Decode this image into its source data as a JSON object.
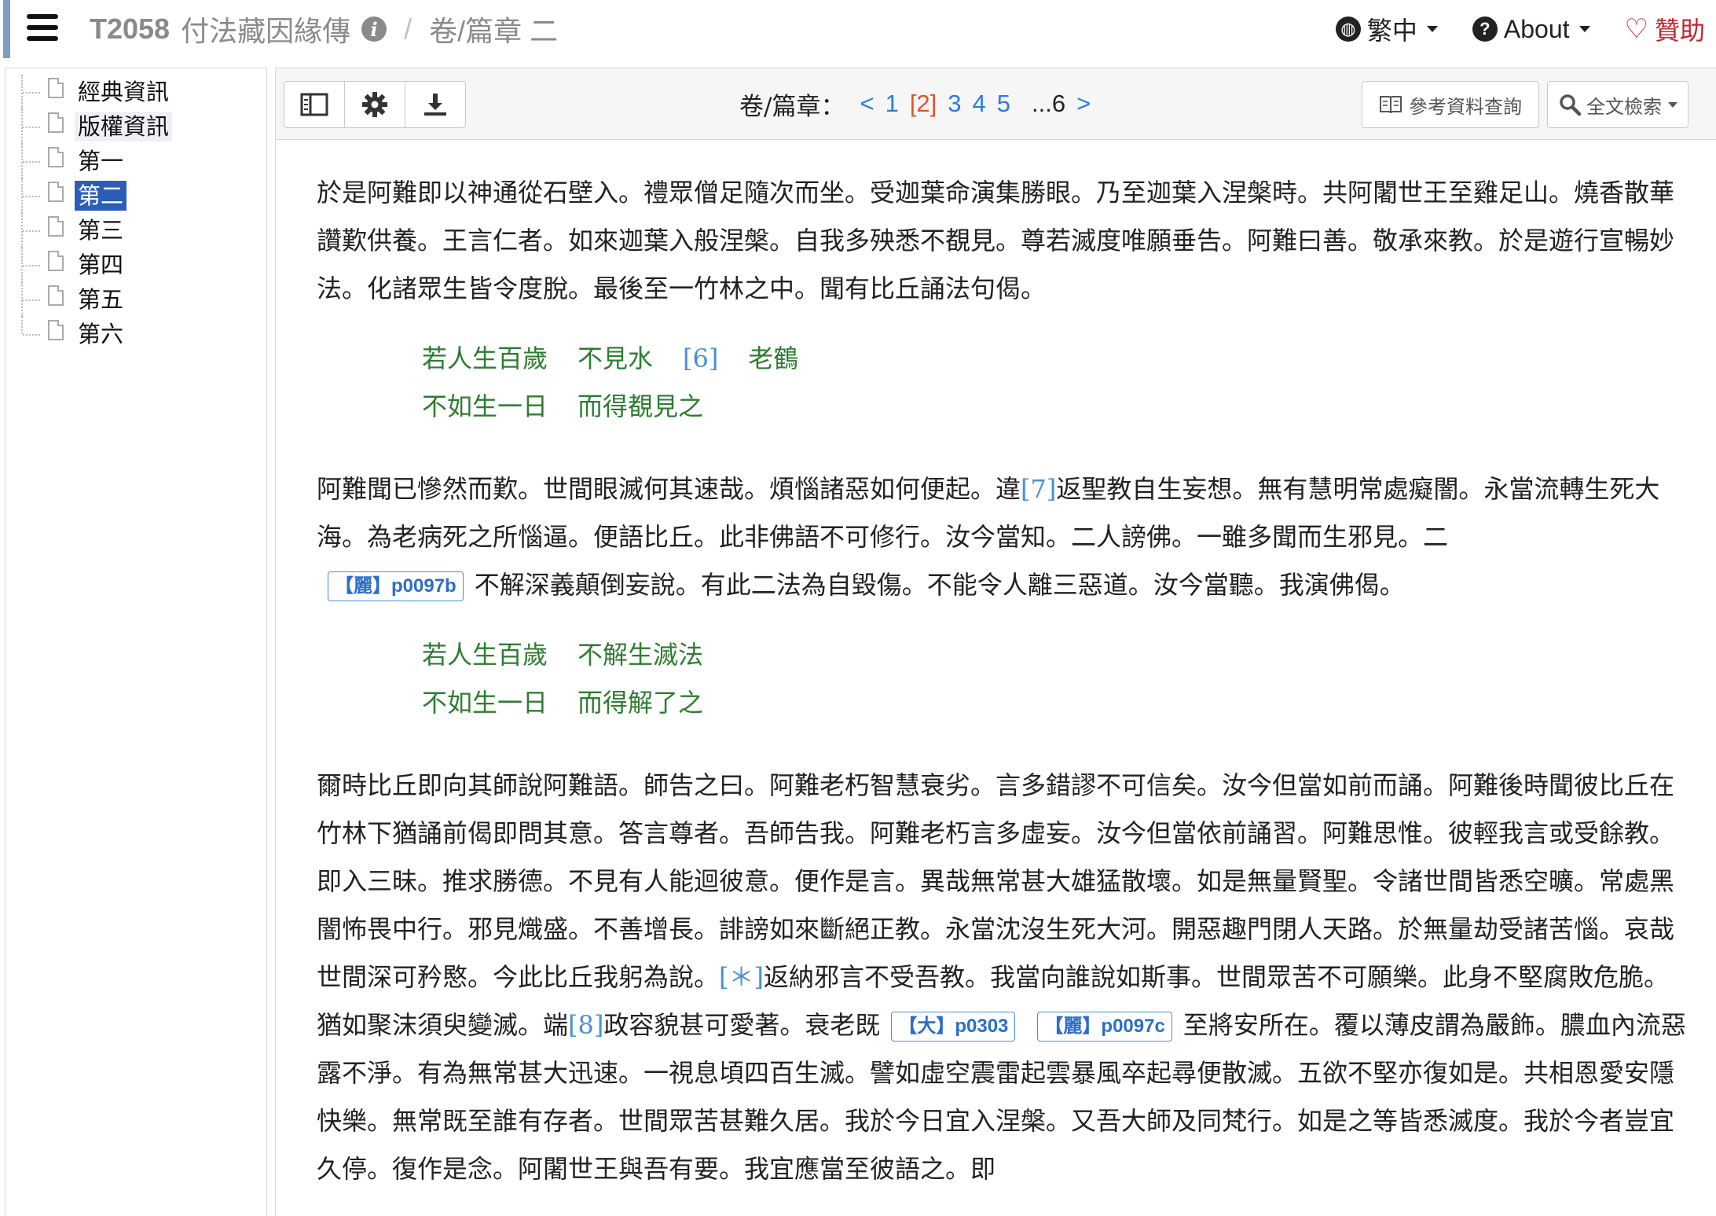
{
  "header": {
    "text_code": "T2058",
    "text_title": "付法藏因緣傳",
    "separator": "/",
    "section": "卷/篇章 二",
    "language_label": "繁中",
    "about_label": "About",
    "donate_label": "贊助",
    "icons": {
      "menu": "hamburger-icon",
      "info": "info-icon",
      "language": "globe-icon",
      "about": "question-circle-icon",
      "donate": "heart-icon"
    }
  },
  "sidebar": {
    "items": [
      {
        "label": "經典資訊"
      },
      {
        "label": "版權資訊"
      },
      {
        "label": "第一"
      },
      {
        "label": "第二"
      },
      {
        "label": "第三"
      },
      {
        "label": "第四"
      },
      {
        "label": "第五"
      },
      {
        "label": "第六"
      }
    ],
    "selected": "第二"
  },
  "toolbar": {
    "juan_label": "卷/篇章：",
    "prev": "<",
    "pages": [
      "1",
      "[2]",
      "3",
      "4",
      "5"
    ],
    "ellipsis_page": "...6",
    "next": ">",
    "current": "[2]",
    "ref_label": "參考資料查詢",
    "search_label": "全文檢索"
  },
  "content": {
    "p1": "於是阿難即以神通從石壁入。禮眾僧足隨次而坐。受迦葉命演集勝眼。乃至迦葉入涅槃時。共阿闍世王至雞足山。燒香散華讚歎供養。王言仁者。如來迦葉入般涅槃。自我多殃悉不覩見。尊若滅度唯願垂告。阿難曰善。敬承來教。於是遊行宣暢妙法。化諸眾生皆令度脫。最後至一竹林之中。聞有比丘誦法句偈。",
    "verse1": {
      "l1a": "若人生百歲",
      "l1b_pre": "不見水",
      "l1b_note": "[6]",
      "l1b_post": "老鶴",
      "l2a": "不如生一日",
      "l2b": "而得覩見之"
    },
    "p2": {
      "a": "阿難聞已慘然而歎。世間眼滅何其速哉。煩惱諸惡如何便起。違",
      "note": "[7]",
      "b": "返聖教自生妄想。無有慧明常處癡闇。永當流轉生死大海。為老病死之所惱逼。便語比丘。此非佛語不可修行。汝今當知。二人謗佛。一雖多聞而生邪見。二",
      "badge": "【麗】p0097b",
      "c": "不解深義顛倒妄說。有此二法為自毀傷。不能令人離三惡道。汝今當聽。我演佛偈。"
    },
    "verse2": {
      "l1a": "若人生百歲",
      "l1b": "不解生滅法",
      "l2a": "不如生一日",
      "l2b": "而得解了之"
    },
    "p3": {
      "a": "爾時比丘即向其師說阿難語。師告之曰。阿難老朽智慧衰劣。言多錯謬不可信矣。汝今但當如前而誦。阿難後時聞彼比丘在竹林下猶誦前偈即問其意。答言尊者。吾師告我。阿難老朽言多虛妄。汝今但當依前誦習。阿難思惟。彼輕我言或受餘教。即入三昧。推求勝德。不見有人能迴彼意。便作是言。異哉無常甚大雄猛散壞。如是無量賢聖。令諸世間皆悉空曠。常處黑闇怖畏中行。邪見熾盛。不善增長。誹謗如來斷絕正教。永當沈沒生死大河。開惡趣門閉人天路。於無量劫受諸苦惱。哀哉世間深可矜愍。今此比丘我躬為說。",
      "note1": "[＊]",
      "b": "返納邪言不受吾教。我當向誰說如斯事。世間眾苦不可願樂。此身不堅腐敗危脆。猶如聚沫須臾變滅。端",
      "note2": "[8]",
      "c": "政容貌甚可愛著。衰老既",
      "badge1": "【大】p0303",
      "badge2": "【麗】p0097c",
      "d": "至將安所在。覆以薄皮謂為嚴飾。膿血內流惡露不淨。有為無常甚大迅速。一視息頃四百生滅。譬如虛空震雷起雲暴風卒起尋便散滅。五欲不堅亦復如是。共相恩愛安隱快樂。無常既至誰有存者。世間眾苦甚難久居。我於今日宜入涅槃。又吾大師及同梵行。如是之等皆悉滅度。我於今者豈宜久停。復作是念。阿闍世王與吾有要。我宜應當至彼語之。即"
    }
  }
}
